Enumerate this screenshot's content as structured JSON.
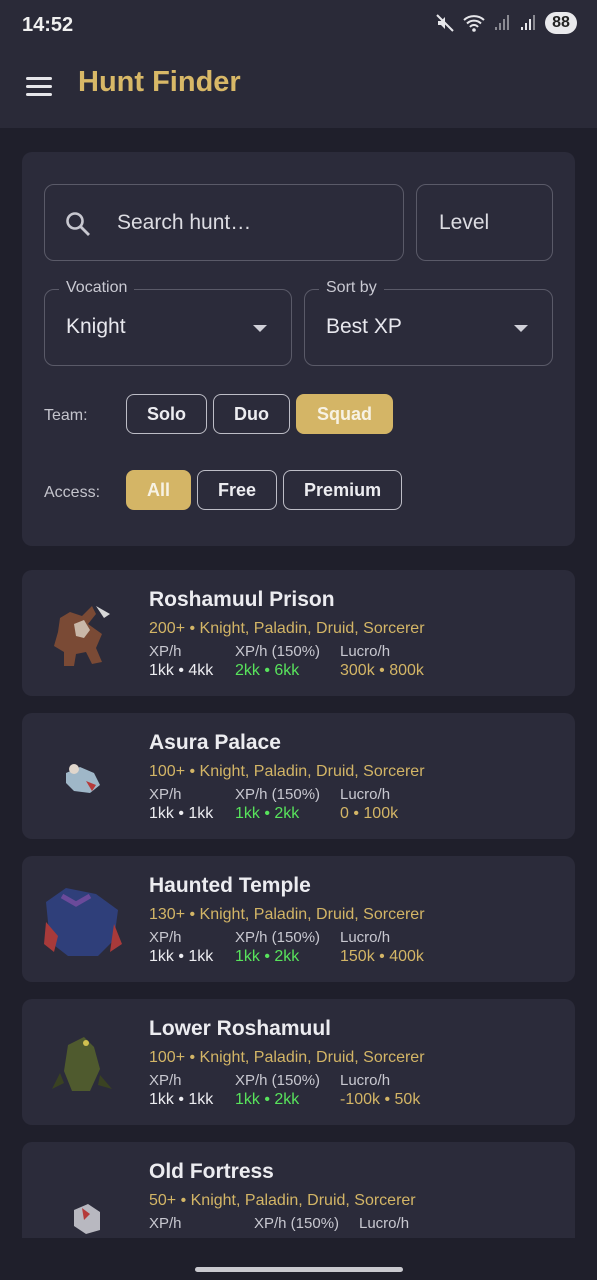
{
  "status": {
    "time": "14:52",
    "battery": "88"
  },
  "app": {
    "title": "Hunt Finder"
  },
  "filters": {
    "search_placeholder": "Search hunt…",
    "level_placeholder": "Level",
    "vocation_label": "Vocation",
    "vocation_value": "Knight",
    "sort_label": "Sort by",
    "sort_value": "Best XP",
    "team_label": "Team:",
    "team_options": [
      "Solo",
      "Duo",
      "Squad"
    ],
    "team_selected": "Squad",
    "access_label": "Access:",
    "access_options": [
      "All",
      "Free",
      "Premium"
    ],
    "access_selected": "All"
  },
  "hunts": [
    {
      "name": "Roshamuul Prison",
      "subtitle": "200+ • Knight, Paladin, Druid, Sorcerer",
      "xp_label": "XP/h",
      "xp": "1kk • 4kk",
      "xp150_label": "XP/h (150%)",
      "xp150": "2kk • 6kk",
      "profit_label": "Lucro/h",
      "profit": "300k • 800k"
    },
    {
      "name": "Asura Palace",
      "subtitle": "100+ • Knight, Paladin, Druid, Sorcerer",
      "xp_label": "XP/h",
      "xp": "1kk • 1kk",
      "xp150_label": "XP/h (150%)",
      "xp150": "1kk • 2kk",
      "profit_label": "Lucro/h",
      "profit": "0 • 100k"
    },
    {
      "name": "Haunted Temple",
      "subtitle": "130+ • Knight, Paladin, Druid, Sorcerer",
      "xp_label": "XP/h",
      "xp": "1kk • 1kk",
      "xp150_label": "XP/h (150%)",
      "xp150": "1kk • 2kk",
      "profit_label": "Lucro/h",
      "profit": "150k • 400k"
    },
    {
      "name": "Lower Roshamuul",
      "subtitle": "100+ • Knight, Paladin, Druid, Sorcerer",
      "xp_label": "XP/h",
      "xp": "1kk • 1kk",
      "xp150_label": "XP/h (150%)",
      "xp150": "1kk • 2kk",
      "profit_label": "Lucro/h",
      "profit": "-100k • 50k"
    },
    {
      "name": "Old Fortress",
      "subtitle": "50+ • Knight, Paladin, Druid, Sorcerer",
      "xp_label": "XP/h",
      "xp": "",
      "xp150_label": "XP/h (150%)",
      "xp150": "",
      "profit_label": "Lucro/h",
      "profit": ""
    }
  ]
}
